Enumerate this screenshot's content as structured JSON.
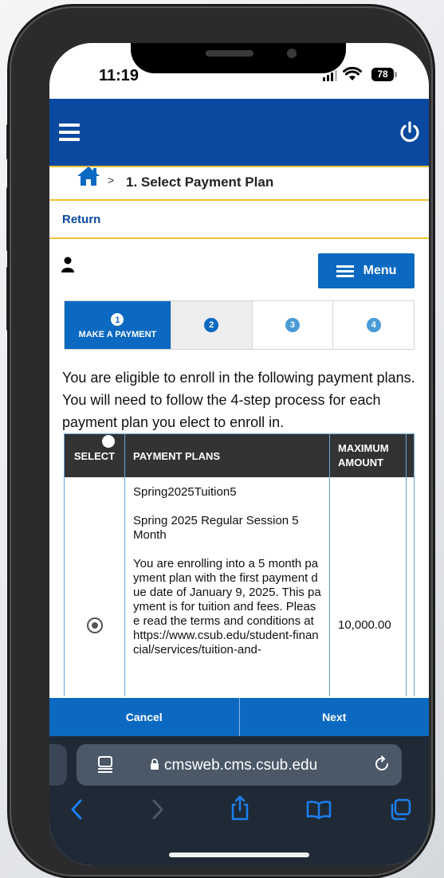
{
  "status_bar": {
    "time": "11:19",
    "battery": "78"
  },
  "breadcrumb": {
    "separator": ">",
    "title": "1. Select Payment Plan"
  },
  "return_link": "Return",
  "menu_button": {
    "label": "Menu"
  },
  "steps": [
    {
      "number": "1",
      "label": "MAKE A PAYMENT",
      "active": true
    },
    {
      "number": "2",
      "label": "",
      "active": false
    },
    {
      "number": "3",
      "label": "",
      "active": false
    },
    {
      "number": "4",
      "label": "",
      "active": false
    }
  ],
  "intro_text": "You are eligible to enroll in the following payment plans. You will need to follow the 4-step process for each payment plan you elect to enroll in.",
  "table": {
    "headers": {
      "select": "SELECT",
      "plans": "PAYMENT PLANS",
      "max_amount_line1": "MAXIMUM",
      "max_amount_line2": "AMOUNT"
    },
    "rows": [
      {
        "plan_code": "Spring2025Tuition5",
        "plan_name": "Spring 2025 Regular Session 5 Month",
        "description": "You are enrolling into a 5 month payment plan with the first payment due date of January 9, 2025. This payment is for tuition and fees. Please read the terms and conditions at https://www.csub.edu/student-financial/services/tuition-and-",
        "max_amount": "10,000.00",
        "selected": true
      }
    ]
  },
  "footer": {
    "cancel_label": "Cancel",
    "next_label": "Next"
  },
  "browser": {
    "url": "cmsweb.cms.csub.edu"
  },
  "colors": {
    "header_blue": "#0a49a0",
    "button_blue": "#0b69c1",
    "accent_gold": "#f1c232",
    "table_header": "#333333",
    "safari_bar": "#1f2a36"
  }
}
